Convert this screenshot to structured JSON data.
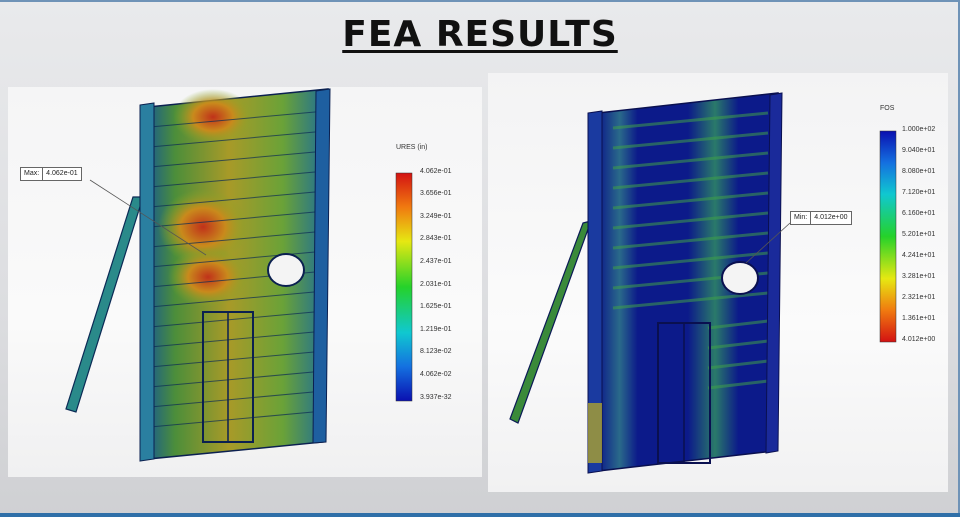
{
  "title": "FEA RESULTS",
  "left_plot": {
    "legend_title": "URES (in)",
    "legend_values": [
      "4.062e-01",
      "3.656e-01",
      "3.249e-01",
      "2.843e-01",
      "2.437e-01",
      "2.031e-01",
      "1.625e-01",
      "1.219e-01",
      "8.123e-02",
      "4.062e-02",
      "3.937e-32"
    ],
    "callout_key": "Max:",
    "callout_value": "4.062e-01"
  },
  "right_plot": {
    "legend_title": "FOS",
    "legend_values": [
      "1.000e+02",
      "9.040e+01",
      "8.080e+01",
      "7.120e+01",
      "6.160e+01",
      "5.201e+01",
      "4.241e+01",
      "3.281e+01",
      "2.321e+01",
      "1.361e+01",
      "4.012e+00"
    ],
    "callout_key": "Min:",
    "callout_value": "4.012e+00"
  },
  "colors": {
    "scale_top": "#d01010",
    "scale_bottom": "#0a10b0",
    "border": "#6f93b7"
  }
}
